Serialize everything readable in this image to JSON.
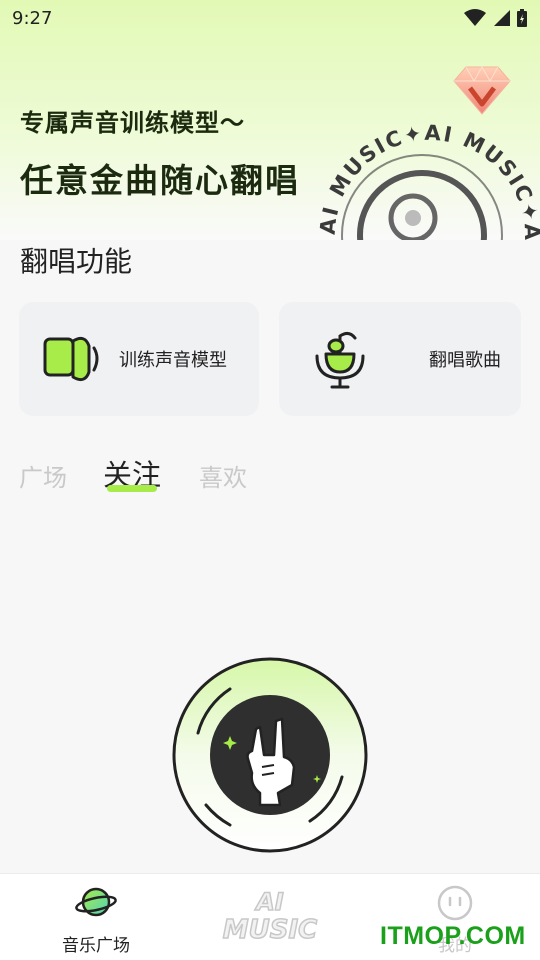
{
  "status_bar": {
    "time": "9:27"
  },
  "banner": {
    "line1": "专属声音训练模型～",
    "line2": "任意金曲随心翻唱",
    "art_text": "AI MUSIC✦AI MUSIC✦AI MU"
  },
  "section": {
    "title": "翻唱功能"
  },
  "features": [
    {
      "label": "训练声音模型",
      "icon": "speaker-icon"
    },
    {
      "label": "翻唱歌曲",
      "icon": "microphone-note-icon"
    }
  ],
  "tabs": [
    {
      "label": "广场",
      "active": false
    },
    {
      "label": "关注",
      "active": true
    },
    {
      "label": "喜欢",
      "active": false
    }
  ],
  "bottom_nav": [
    {
      "label": "音乐广场",
      "icon": "planet-icon",
      "active": true
    },
    {
      "label": "AI MUSIC",
      "icon": "ai-music-logo",
      "active": false
    },
    {
      "label": "我的",
      "icon": "face-icon",
      "active": false
    }
  ],
  "watermark": "ITMOP.COM",
  "colors": {
    "accent": "#a8ec4a",
    "banner_bg": "#e2f9b5",
    "text_dark": "#1c2a10",
    "watermark": "#1aa01a"
  }
}
